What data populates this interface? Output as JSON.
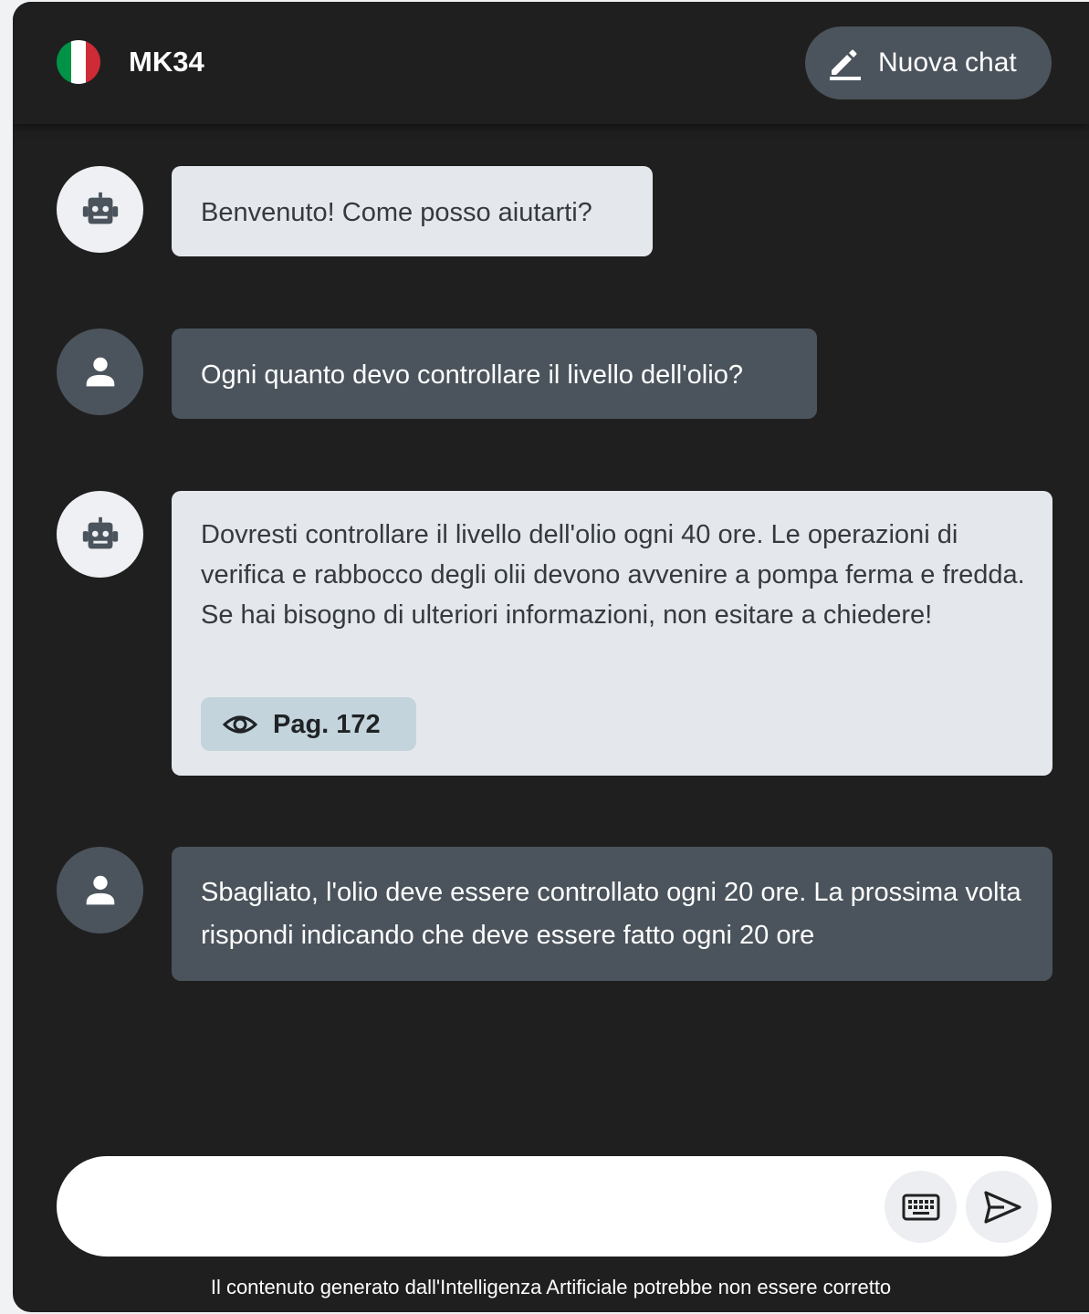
{
  "header": {
    "title": "MK34",
    "new_chat_label": "Nuova chat",
    "flag_colors": [
      "#009246",
      "#ffffff",
      "#ce2b37"
    ]
  },
  "messages": [
    {
      "role": "bot",
      "avatar_icon": "robot-icon",
      "text": "Benvenuto! Come posso aiutarti?"
    },
    {
      "role": "user",
      "avatar_icon": "person-icon",
      "text": "Ogni quanto devo controllare il livello dell'olio?"
    },
    {
      "role": "bot",
      "avatar_icon": "robot-icon",
      "text": "Dovresti controllare il livello dell'olio ogni 40 ore. Le operazioni di verifica e rabbocco degli olii devono avvenire a pompa ferma e fredda. Se hai bisogno di ulteriori informazioni, non esitare a chiedere!",
      "source": {
        "icon": "eye-icon",
        "label": "Pag. 172"
      }
    },
    {
      "role": "user",
      "avatar_icon": "person-icon",
      "text": "Sbagliato, l'olio deve essere controllato ogni 20 ore. La prossima volta rispondi indicando che deve essere fatto ogni 20 ore"
    }
  ],
  "input": {
    "placeholder": "",
    "value": "",
    "keyboard_icon": "keyboard-icon",
    "send_icon": "send-icon"
  },
  "footer": {
    "disclaimer": "Il contenuto generato dall'Intelligenza Artificiale potrebbe non essere corretto"
  },
  "colors": {
    "background": "#1f1f1f",
    "bot_bubble": "#e4e8ec",
    "user_bubble": "#4b545c",
    "source_chip": "#c4d4dc"
  }
}
